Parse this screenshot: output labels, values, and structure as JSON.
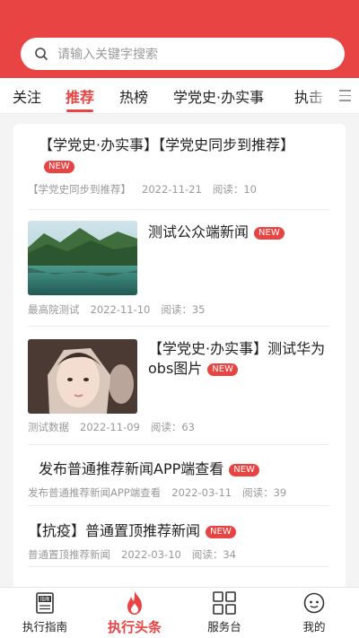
{
  "search": {
    "placeholder": "请输入关键字搜索"
  },
  "tabs": [
    {
      "label": "关注"
    },
    {
      "label": "推荐",
      "active": true
    },
    {
      "label": "热榜"
    },
    {
      "label": "学党史·办实事"
    },
    {
      "label": "执击"
    }
  ],
  "news": [
    {
      "title": "【学党史·办实事】【学党史同步到推荐】",
      "badge": "NEW",
      "source": "【学党史同步到推荐】",
      "date": "2022-11-21",
      "reads": "阅读：10"
    },
    {
      "title": "测试公众端新闻",
      "badge": "NEW",
      "source": "最高院测试",
      "date": "2022-11-10",
      "reads": "阅读：35",
      "thumb_icon": "lake-landscape-image"
    },
    {
      "title": "【学党史·办实事】测试华为obs图片",
      "badge": "NEW",
      "source": "测试数据",
      "date": "2022-11-09",
      "reads": "阅读：63",
      "thumb_icon": "girl-portrait-image"
    },
    {
      "title": "发布普通推荐新闻APP端查看",
      "badge": "NEW",
      "source": "发布普通推荐新闻APP端查看",
      "date": "2022-03-11",
      "reads": "阅读：39"
    },
    {
      "title": "【抗疫】普通置顶推荐新闻",
      "badge": "NEW",
      "source": "普通置顶推荐新闻",
      "date": "2022-03-10",
      "reads": "阅读：34"
    }
  ],
  "bottom_nav": [
    {
      "label": "执行指南",
      "icon": "guide-book-icon",
      "icon_text": "指南"
    },
    {
      "label": "执行头条",
      "icon": "flame-icon",
      "active": true
    },
    {
      "label": "服务台",
      "icon": "grid-icon"
    },
    {
      "label": "我的",
      "icon": "smiley-profile-icon"
    }
  ],
  "colors": {
    "accent": "#e84443",
    "background": "#f4f4f4"
  }
}
